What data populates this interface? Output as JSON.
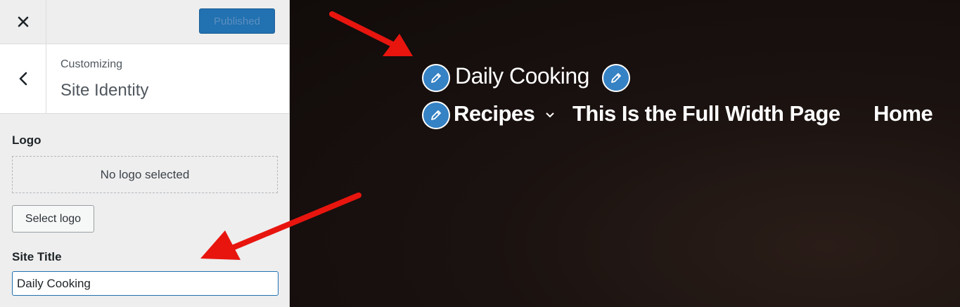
{
  "sidebar": {
    "close_icon": "close-icon",
    "publish_label": "Published",
    "back_icon": "chevron-left-icon",
    "breadcrumb": "Customizing",
    "section_title": "Site Identity",
    "logo": {
      "label": "Logo",
      "placeholder_text": "No logo selected",
      "select_button": "Select logo"
    },
    "site_title": {
      "label": "Site Title",
      "value": "Daily Cooking"
    }
  },
  "preview": {
    "site_title": "Daily Cooking",
    "edit_icon": "pencil-icon",
    "nav": [
      {
        "label": "Recipes",
        "has_submenu": true
      },
      {
        "label": "This Is the Full Width Page"
      },
      {
        "label": "Home"
      }
    ]
  },
  "colors": {
    "accent": "#2271b1",
    "annotation_arrow": "#e8150f",
    "preview_bg": "#1a1210"
  }
}
